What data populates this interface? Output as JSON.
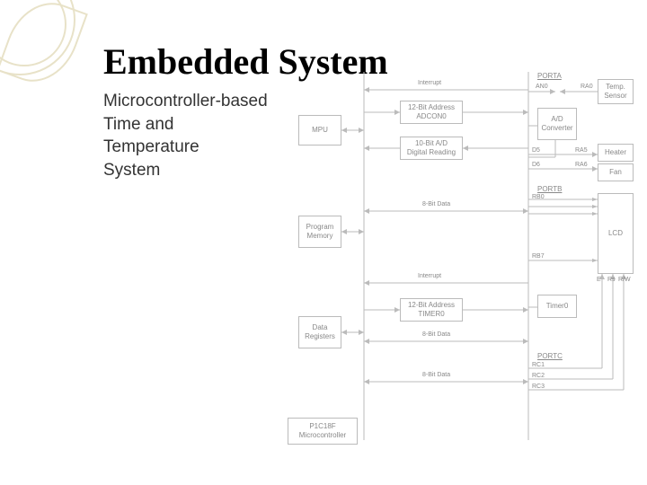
{
  "slide": {
    "title": "Embedded System",
    "subtitle_l1": "Microcontroller-based",
    "subtitle_l2": "Time and",
    "subtitle_l3": "Temperature",
    "subtitle_l4": "System"
  },
  "diagram": {
    "blocks": {
      "mpu": "MPU",
      "prog_mem_l1": "Program",
      "prog_mem_l2": "Memory",
      "data_reg_l1": "Data",
      "data_reg_l2": "Registers",
      "mcu_l1": "P1C18F",
      "mcu_l2": "Microcontroller",
      "addr_adc_l1": "12-Bit Address",
      "addr_adc_l2": "ADCON0",
      "dig_read_l1": "10-Bit A/D",
      "dig_read_l2": "Digital Reading",
      "addr_tmr_l1": "12-Bit Address",
      "addr_tmr_l2": "TIMER0",
      "ad_conv_l1": "A/D",
      "ad_conv_l2": "Converter",
      "timer0": "Timer0",
      "lcd": "LCD",
      "temp_l1": "Temp.",
      "temp_l2": "Sensor",
      "heater": "Heater",
      "fan": "Fan"
    },
    "labels": {
      "interrupt1": "Interrupt",
      "interrupt2": "Interrupt",
      "bus8a": "8-Bit Data",
      "bus8b": "8-Bit Data",
      "bus8c": "8-Bit Data",
      "porta": "PORTA",
      "portb": "PORTB",
      "portc": "PORTC"
    },
    "pins": {
      "an0": "AN0",
      "ra0": "RA0",
      "d5": "D5",
      "d6": "D6",
      "ra5": "RA5",
      "ra6": "RA6",
      "rb0": "RB0",
      "rb7": "RB7",
      "e": "E",
      "rs": "Rs",
      "rw": "R/W",
      "rc1": "RC1",
      "rc2": "RC2",
      "rc3": "RC3"
    }
  }
}
